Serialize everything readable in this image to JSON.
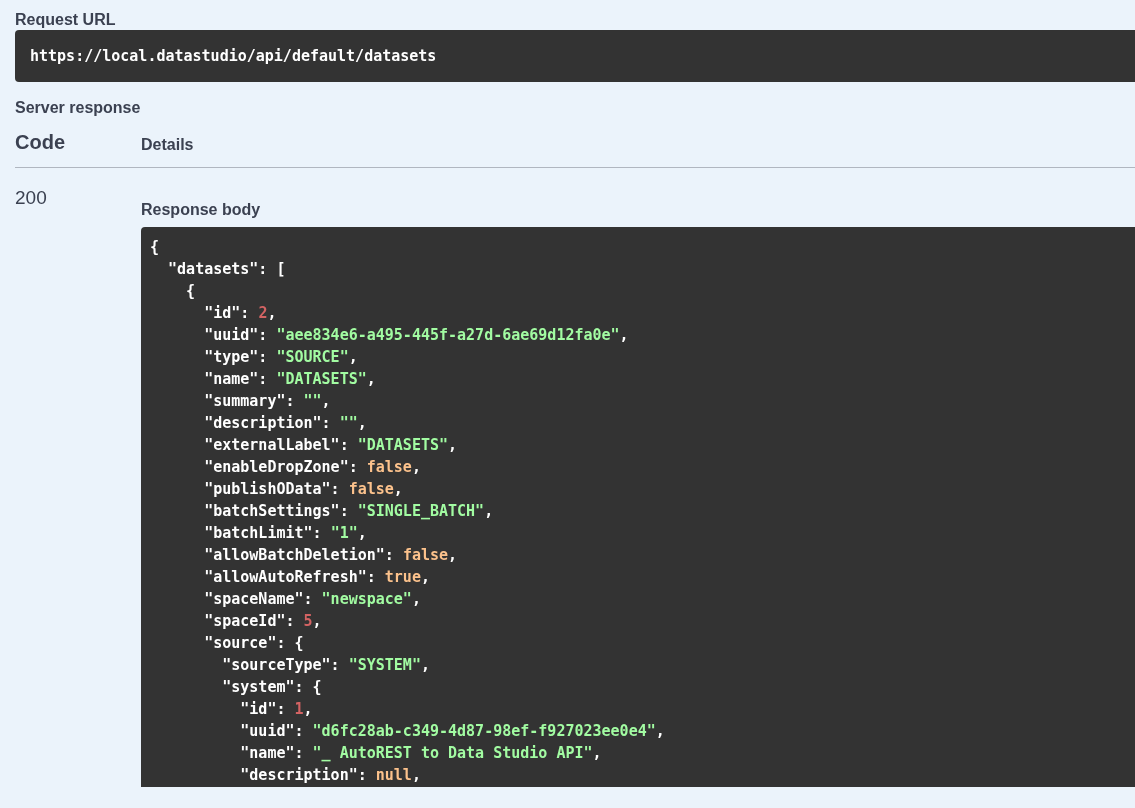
{
  "request_url": {
    "label": "Request URL",
    "url": "https://local.datastudio/api/default/datasets"
  },
  "server_response": {
    "label": "Server response",
    "columns": [
      "Code",
      "Details"
    ],
    "code": "200",
    "body_label": "Response body",
    "body_lines": [
      [
        {
          "kind": "plain",
          "text": "{"
        }
      ],
      [
        {
          "kind": "plain",
          "text": "  \"datasets\": ["
        }
      ],
      [
        {
          "kind": "plain",
          "text": "    {"
        }
      ],
      [
        {
          "kind": "plain",
          "text": "      \"id\": "
        },
        {
          "kind": "number",
          "text": "2"
        },
        {
          "kind": "plain",
          "text": ","
        }
      ],
      [
        {
          "kind": "plain",
          "text": "      \"uuid\": "
        },
        {
          "kind": "string",
          "text": "\"aee834e6-a495-445f-a27d-6ae69d12fa0e\""
        },
        {
          "kind": "plain",
          "text": ","
        }
      ],
      [
        {
          "kind": "plain",
          "text": "      \"type\": "
        },
        {
          "kind": "string",
          "text": "\"SOURCE\""
        },
        {
          "kind": "plain",
          "text": ","
        }
      ],
      [
        {
          "kind": "plain",
          "text": "      \"name\": "
        },
        {
          "kind": "string",
          "text": "\"DATASETS\""
        },
        {
          "kind": "plain",
          "text": ","
        }
      ],
      [
        {
          "kind": "plain",
          "text": "      \"summary\": "
        },
        {
          "kind": "string",
          "text": "\"\""
        },
        {
          "kind": "plain",
          "text": ","
        }
      ],
      [
        {
          "kind": "plain",
          "text": "      \"description\": "
        },
        {
          "kind": "string",
          "text": "\"\""
        },
        {
          "kind": "plain",
          "text": ","
        }
      ],
      [
        {
          "kind": "plain",
          "text": "      \"externalLabel\": "
        },
        {
          "kind": "string",
          "text": "\"DATASETS\""
        },
        {
          "kind": "plain",
          "text": ","
        }
      ],
      [
        {
          "kind": "plain",
          "text": "      \"enableDropZone\": "
        },
        {
          "kind": "literal",
          "text": "false"
        },
        {
          "kind": "plain",
          "text": ","
        }
      ],
      [
        {
          "kind": "plain",
          "text": "      \"publishOData\": "
        },
        {
          "kind": "literal",
          "text": "false"
        },
        {
          "kind": "plain",
          "text": ","
        }
      ],
      [
        {
          "kind": "plain",
          "text": "      \"batchSettings\": "
        },
        {
          "kind": "string",
          "text": "\"SINGLE_BATCH\""
        },
        {
          "kind": "plain",
          "text": ","
        }
      ],
      [
        {
          "kind": "plain",
          "text": "      \"batchLimit\": "
        },
        {
          "kind": "string",
          "text": "\"1\""
        },
        {
          "kind": "plain",
          "text": ","
        }
      ],
      [
        {
          "kind": "plain",
          "text": "      \"allowBatchDeletion\": "
        },
        {
          "kind": "literal",
          "text": "false"
        },
        {
          "kind": "plain",
          "text": ","
        }
      ],
      [
        {
          "kind": "plain",
          "text": "      \"allowAutoRefresh\": "
        },
        {
          "kind": "literal",
          "text": "true"
        },
        {
          "kind": "plain",
          "text": ","
        }
      ],
      [
        {
          "kind": "plain",
          "text": "      \"spaceName\": "
        },
        {
          "kind": "string",
          "text": "\"newspace\""
        },
        {
          "kind": "plain",
          "text": ","
        }
      ],
      [
        {
          "kind": "plain",
          "text": "      \"spaceId\": "
        },
        {
          "kind": "number",
          "text": "5"
        },
        {
          "kind": "plain",
          "text": ","
        }
      ],
      [
        {
          "kind": "plain",
          "text": "      \"source\": {"
        }
      ],
      [
        {
          "kind": "plain",
          "text": "        \"sourceType\": "
        },
        {
          "kind": "string",
          "text": "\"SYSTEM\""
        },
        {
          "kind": "plain",
          "text": ","
        }
      ],
      [
        {
          "kind": "plain",
          "text": "        \"system\": {"
        }
      ],
      [
        {
          "kind": "plain",
          "text": "          \"id\": "
        },
        {
          "kind": "number",
          "text": "1"
        },
        {
          "kind": "plain",
          "text": ","
        }
      ],
      [
        {
          "kind": "plain",
          "text": "          \"uuid\": "
        },
        {
          "kind": "string",
          "text": "\"d6fc28ab-c349-4d87-98ef-f927023ee0e4\""
        },
        {
          "kind": "plain",
          "text": ","
        }
      ],
      [
        {
          "kind": "plain",
          "text": "          \"name\": "
        },
        {
          "kind": "string",
          "text": "\"_ AutoREST to Data Studio API\""
        },
        {
          "kind": "plain",
          "text": ","
        }
      ],
      [
        {
          "kind": "plain",
          "text": "          \"description\": "
        },
        {
          "kind": "literal",
          "text": "null"
        },
        {
          "kind": "plain",
          "text": ","
        }
      ]
    ]
  }
}
